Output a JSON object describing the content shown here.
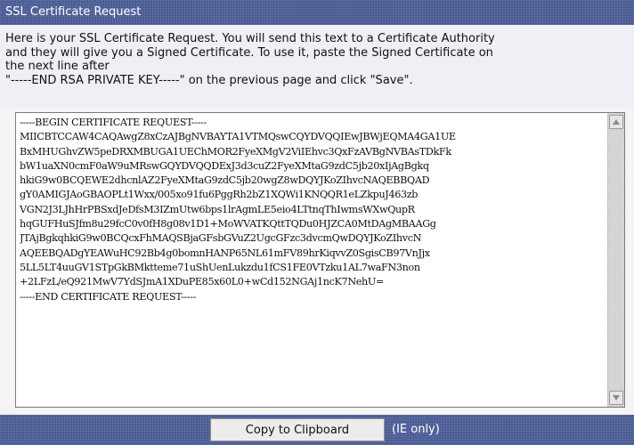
{
  "header": {
    "title": "SSL Certificate Request"
  },
  "intro": {
    "line1": "Here is your SSL Certificate Request. You will send this text to a Certificate Authority",
    "line2": "and they will give you a Signed Certificate. To use it, paste the Signed Certificate on",
    "line3": "the next line after",
    "line4": "\"-----END RSA PRIVATE KEY-----\" on the previous page and click \"Save\"."
  },
  "csr": {
    "text": "-----BEGIN CERTIFICATE REQUEST-----\nMIICBTCCAW4CAQAwgZ8xCzAJBgNVBAYTA1VTMQswCQYDVQQIEwJBWjEQMA4GA1UE\nBxMHUGhvZW5peDRXMBUGA1UEChMOR2FyeXMgV2ViIEhvc3QxFzAVBgNVBAsTDkFk\nbW1uaXN0cmF0aW9uMRswGQYDVQQDExJ3d3cuZ2FyeXMtaG9zdC5jb20xIjAgBgkq\nhkiG9w0BCQEWE2dhcnlAZ2FyeXMtaG9zdC5jb20wgZ8wDQYJKoZIhvcNAQEBBQAD\ngY0AMIGJAoGBAOPLt1Wxx/005xo91fu6PggRh2bZ1XQWi1KNQQR1eLZkpuJ463zb\nVGN2J3LJhHrPBSxdJeDfsM3IZmUtw6bps1lrAgmLE5eio4LTtnqThIwmsWXwQupR\nhqGUFHuSJfm8u29fcC0v0fH8g08v1D1+MoWVATKQttTQDu0HJZCA0MtDAgMBAAGg\nJTAjBgkqhkiG9w0BCQcxFhMAQSBjaGFsbGVuZ2UgcGFzc3dvcmQwDQYJKoZIhvcN\nAQEEBQADgYEAWuHC92Bb4g0bomnHANP65NL61mFV89hrKiqvvZ0SgisCB97VnJjx\n5LL5LT4uuGV1STpGkBMktteme71uShUenLukzdu1fCS1FE0VTzku1AL7waFN3non\n+2LFzL/eQ921MwV7YdSJmA1XDuPE85x60L0+wCd152NGAj1ncK7NehU=\n-----END CERTIFICATE REQUEST-----"
  },
  "footer": {
    "copy_button_label": "Copy to Clipboard",
    "note": "(IE only)"
  },
  "icons": {
    "scroll_up": "triangle-up-icon",
    "scroll_down": "triangle-down-icon"
  },
  "colors": {
    "header_bg": "#4a5c95",
    "intro_bg": "#eef0f5"
  }
}
